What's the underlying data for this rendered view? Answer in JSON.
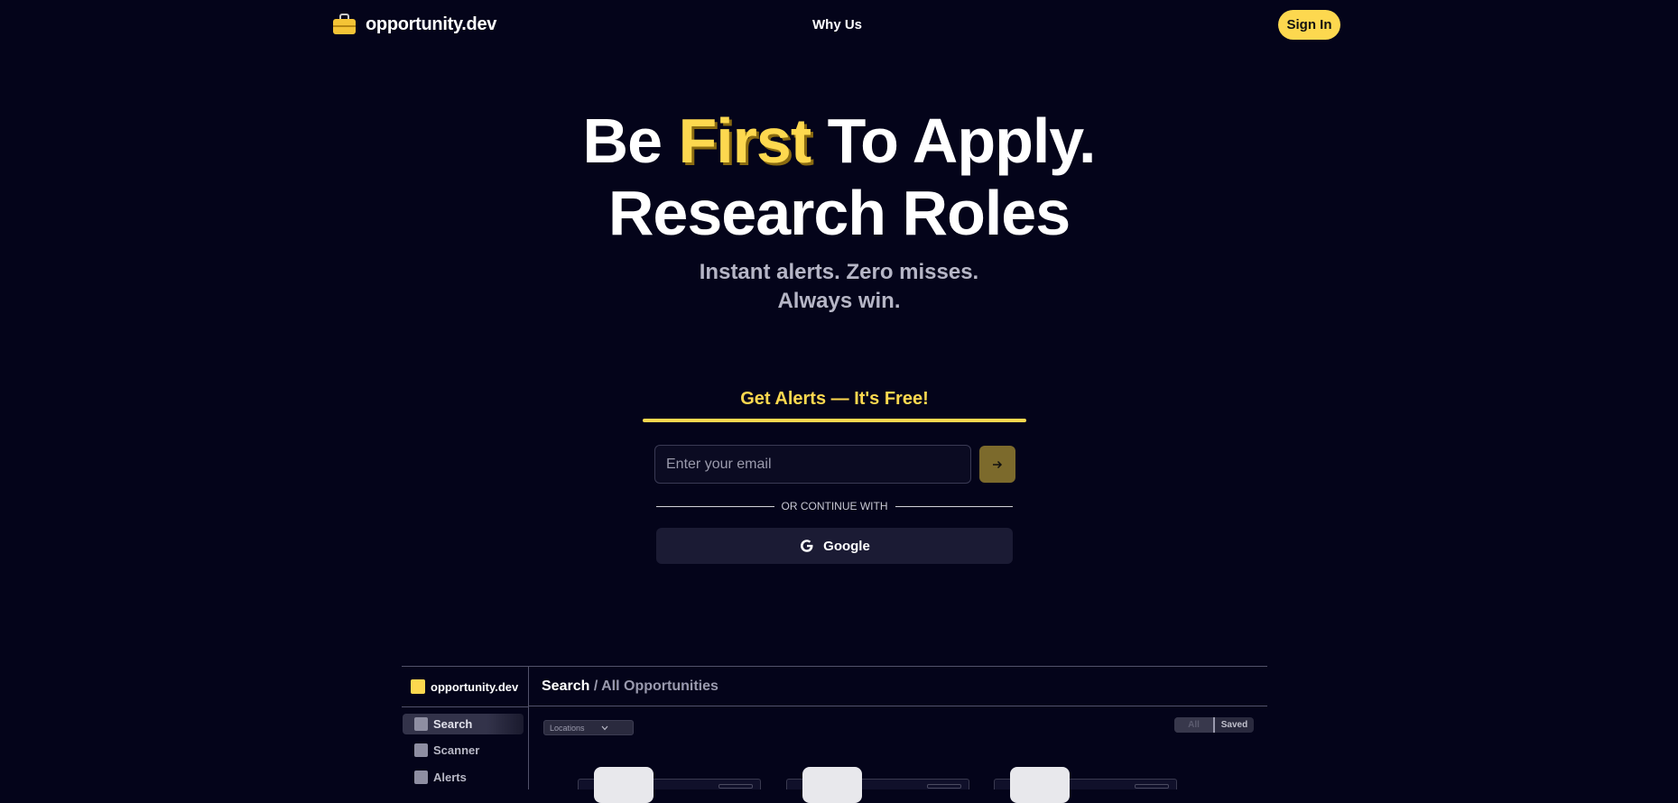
{
  "header": {
    "brand": "opportunity.dev",
    "nav_why": "Why Us",
    "signin_label": "Sign In"
  },
  "hero": {
    "line1_a": "Be ",
    "line1_highlight": "First",
    "line1_b": " To Apply.",
    "line2": "Research Roles",
    "sub1": "Instant alerts. Zero misses.",
    "sub2": "Always win."
  },
  "signup": {
    "cta_label": "Get Alerts — It's Free!",
    "email_placeholder": "Enter your email",
    "submit_icon": "arrow-right-icon",
    "divider_text": "OR CONTINUE WITH",
    "google_label": "Google"
  },
  "preview": {
    "brand": "opportunity.dev",
    "title": "Search",
    "crumb": " / All Opportunities",
    "sidebar": [
      {
        "label": "Search"
      },
      {
        "label": "Scanner"
      },
      {
        "label": "Alerts"
      }
    ],
    "locations_label": "Locations",
    "toggle": {
      "all": "All",
      "saved": "Saved"
    }
  },
  "colors": {
    "background": "#04041a",
    "accent": "#fdd84f",
    "muted_text": "#b6b6c6"
  }
}
